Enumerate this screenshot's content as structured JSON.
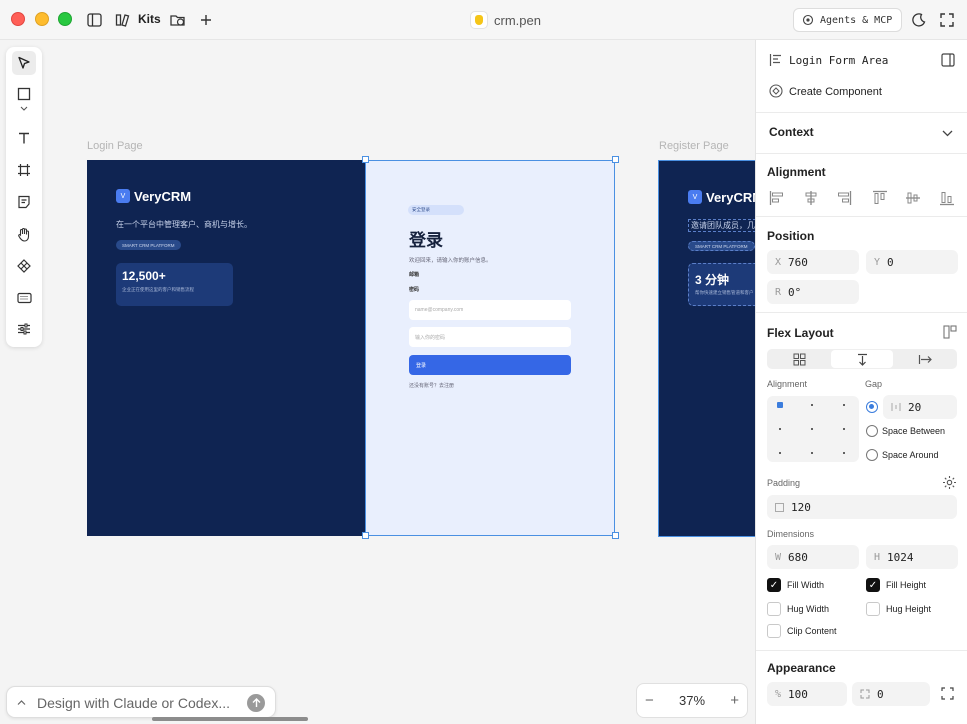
{
  "titlebar": {
    "kits_label": "Kits",
    "file_name": "crm.pen",
    "agents_button": "Agents & MCP"
  },
  "canvas": {
    "login_frame_label": "Login Page",
    "register_frame_label": "Register Page",
    "login": {
      "brand_logo": "V",
      "brand": "VeryCRM",
      "tagline": "在一个平台中管理客户、商机与增长。",
      "pill": "SMART CRM PLATFORM",
      "stat_value": "12,500+",
      "stat_desc": "企业正在使用这里的客户和销售流程",
      "form_pill": "安全登录",
      "form_title": "登录",
      "form_subtitle": "欢迎回来，请输入你的账户信息。",
      "email_label": "邮箱",
      "password_label": "密码",
      "email_placeholder": "name@company.com",
      "password_placeholder": "输入你的密码",
      "button": "登录",
      "footer": "还没有账号？去注册"
    },
    "register": {
      "brand_logo": "V",
      "brand": "VeryCRM",
      "tagline": "邀请团队成员，几分",
      "pill": "SMART CRM PLATFORM",
      "stat_value": "3 分钟",
      "stat_desc": "帮你快速建立销售管道和客户"
    }
  },
  "prompt": {
    "placeholder": "Design with Claude or Codex..."
  },
  "zoom": {
    "minus": "−",
    "level": "37%",
    "plus": "+"
  },
  "panel": {
    "layer_name": "Login Form Area",
    "create_component": "Create Component",
    "context": "Context",
    "alignment": "Alignment",
    "position": "Position",
    "x_label": "X",
    "x_value": "760",
    "y_label": "Y",
    "y_value": "0",
    "r_label": "R",
    "r_value": "0°",
    "flex_layout": "Flex Layout",
    "alignment_sub": "Alignment",
    "gap_label": "Gap",
    "gap_value": "20",
    "space_between": "Space Between",
    "space_around": "Space Around",
    "padding": "Padding",
    "padding_value": "120",
    "dimensions": "Dimensions",
    "w_label": "W",
    "w_value": "680",
    "h_label": "H",
    "h_value": "1024",
    "fill_width": "Fill Width",
    "fill_height": "Fill Height",
    "hug_width": "Hug Width",
    "hug_height": "Hug Height",
    "clip_content": "Clip Content",
    "appearance": "Appearance",
    "opacity_label": "%",
    "opacity_value": "100",
    "radius_value": "0"
  },
  "colors": {
    "accent": "#4a90e2",
    "frame_dark": "#0f2452",
    "form_bg": "#e9effd",
    "primary_button": "#3567e6"
  }
}
